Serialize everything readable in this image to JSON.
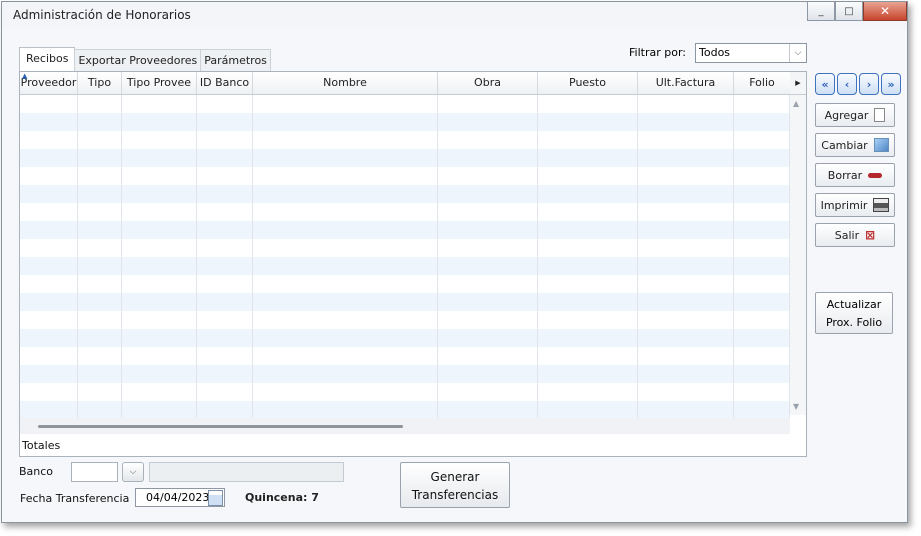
{
  "window": {
    "title": "Administración de Honorarios"
  },
  "caption": {
    "minimize": "_",
    "maximize": "□",
    "close": "✕"
  },
  "tabs": [
    "Recibos",
    "Exportar Proveedores",
    "Parámetros"
  ],
  "filter": {
    "label": "Filtrar por:",
    "value": "Todos"
  },
  "grid": {
    "columns": [
      "Proveedor",
      "Tipo",
      "Tipo Provee",
      "ID Banco",
      "Nombre",
      "Obra",
      "Puesto",
      "Ult.Factura",
      "Folio"
    ],
    "rows": []
  },
  "totals_label": "Totales",
  "actions": {
    "agregar": "Agregar",
    "cambiar": "Cambiar",
    "borrar": "Borrar",
    "imprimir": "Imprimir",
    "salir": "Salir",
    "actualizar_line1": "Actualizar",
    "actualizar_line2": "Prox. Folio"
  },
  "banco": {
    "label": "Banco",
    "value": "",
    "name": ""
  },
  "fecha": {
    "label": "Fecha Transferencia",
    "value": "04/04/2023"
  },
  "quincena": "Quincena: 7",
  "generar": {
    "line1": "Generar",
    "line2": "Transferencias"
  }
}
